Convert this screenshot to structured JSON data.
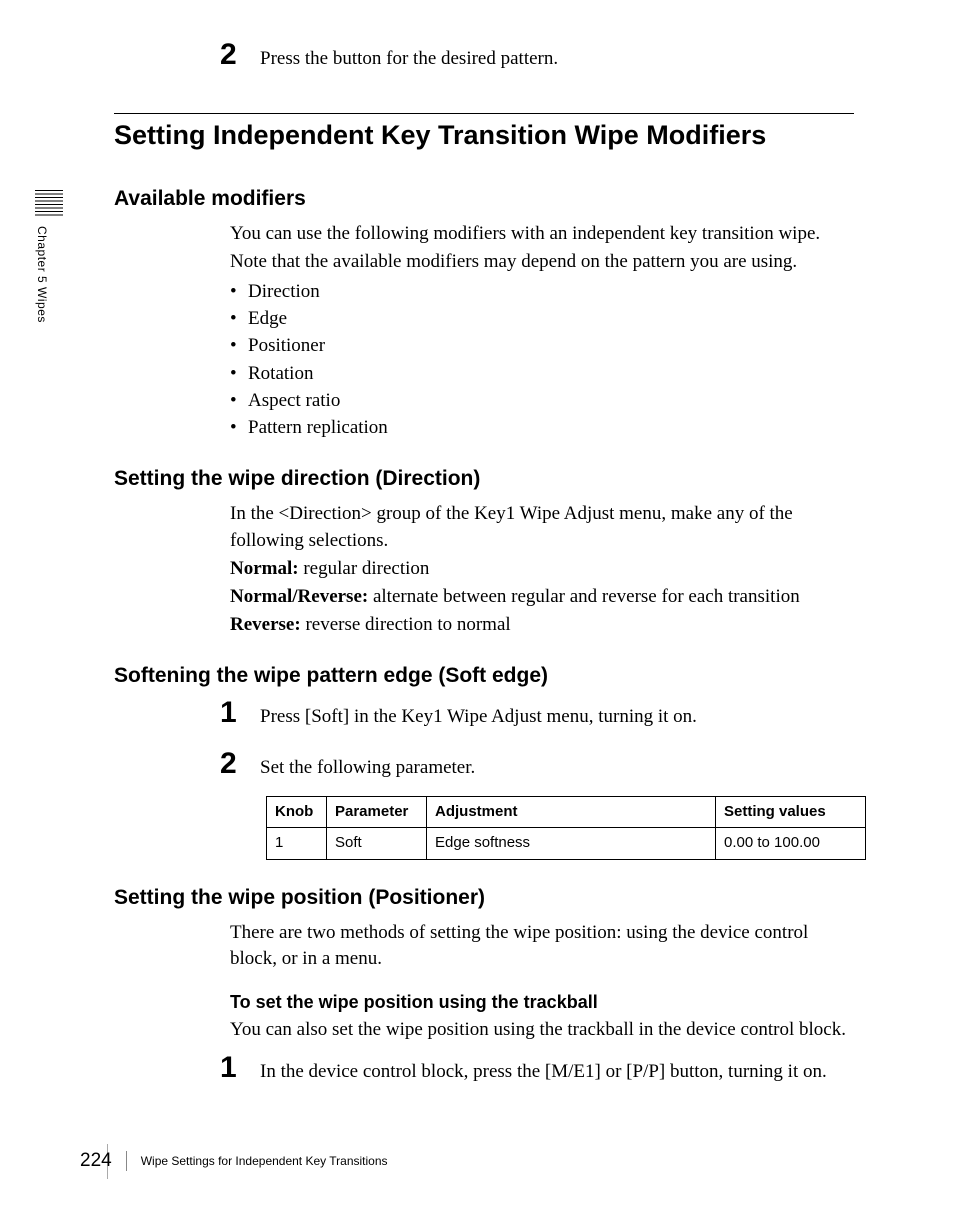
{
  "side": {
    "chapter_label": "Chapter 5  Wipes"
  },
  "top_step": {
    "num": "2",
    "text": "Press the button for the desired pattern."
  },
  "section_title": "Setting Independent Key Transition Wipe Modifiers",
  "modifiers": {
    "heading": "Available modifiers",
    "intro1": "You can use the following modifiers with an independent key transition wipe.",
    "intro2": "Note that the available modifiers may depend on the pattern you are using.",
    "items": [
      "Direction",
      "Edge",
      "Positioner",
      "Rotation",
      "Aspect ratio",
      "Pattern replication"
    ]
  },
  "direction": {
    "heading": "Setting the wipe direction (Direction)",
    "intro": "In the <Direction> group of the Key1 Wipe Adjust menu, make any of the following selections.",
    "defs": [
      {
        "term": "Normal:",
        "desc": " regular direction"
      },
      {
        "term": "Normal/Reverse:",
        "desc": " alternate between regular and reverse for each transition"
      },
      {
        "term": "Reverse:",
        "desc": " reverse direction to normal"
      }
    ]
  },
  "softedge": {
    "heading": "Softening the wipe pattern edge (Soft edge)",
    "steps": [
      {
        "num": "1",
        "text": "Press [Soft] in the Key1 Wipe Adjust menu, turning it on."
      },
      {
        "num": "2",
        "text": "Set the following parameter."
      }
    ],
    "table": {
      "headers": [
        "Knob",
        "Parameter",
        "Adjustment",
        "Setting values"
      ],
      "row": [
        "1",
        "Soft",
        "Edge softness",
        "0.00 to 100.00"
      ]
    }
  },
  "positioner": {
    "heading": "Setting the wipe position (Positioner)",
    "intro": "There are two methods of setting the wipe position: using the device control block, or in a menu.",
    "sub_heading": "To set the wipe position using the trackball",
    "sub_intro": "You can also set the wipe position using the trackball in the device control block.",
    "step": {
      "num": "1",
      "text": "In the device control block, press the [M/E1] or [P/P] button, turning it on."
    }
  },
  "footer": {
    "page": "224",
    "text": "Wipe Settings for Independent Key Transitions"
  }
}
